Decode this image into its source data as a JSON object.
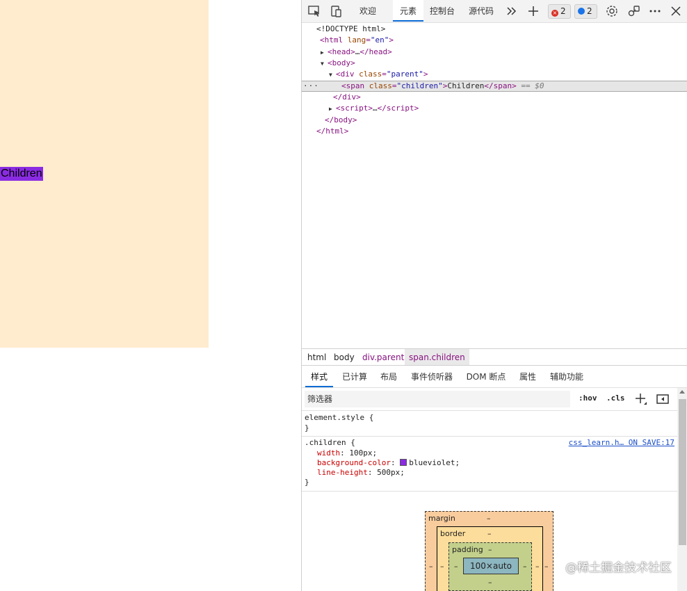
{
  "preview": {
    "children_text": "Children",
    "parent_color": "#ffebcd",
    "children_color": "#8a2be2"
  },
  "toolbar": {
    "tabs": [
      "欢迎",
      "元素",
      "控制台",
      "源代码"
    ],
    "active_tab": "元素",
    "errors_count": "2",
    "messages_count": "2",
    "icons": [
      "inspect-icon",
      "device-toggle-icon",
      "more-tabs-icon",
      "add-tab-icon",
      "settings-icon",
      "connect-icon",
      "more-icon",
      "close-icon"
    ]
  },
  "dom": {
    "doctype": "<!DOCTYPE html>",
    "html_tag": "html",
    "html_attr_name": "lang",
    "html_attr_val": "\"en\"",
    "head_collapsed": "head",
    "head_ellipsis": "…",
    "body_tag": "body",
    "div_tag": "div",
    "div_attr_name": "class",
    "div_attr_val": "\"parent\"",
    "span_tag": "span",
    "span_attr_name": "class",
    "span_attr_val": "\"children\"",
    "span_text": "Children",
    "selected_marker": "== $0",
    "script_tag": "script",
    "script_ellipsis": "…",
    "dots": "···"
  },
  "breadcrumb": [
    "html",
    "body",
    "div.parent",
    "span.children"
  ],
  "subtabs": [
    "样式",
    "已计算",
    "布局",
    "事件侦听器",
    "DOM 断点",
    "属性",
    "辅助功能"
  ],
  "filter": {
    "placeholder": "筛选器",
    "hov": ":hov",
    "cls": ".cls"
  },
  "styles": {
    "element_style_selector": "element.style {",
    "close_brace": "}",
    "children_selector": ".children {",
    "source_link": "css_learn.h… ON SAVE:17",
    "declarations": [
      {
        "prop": "width",
        "value": "100px;"
      },
      {
        "prop": "background-color",
        "value": "blueviolet;"
      },
      {
        "prop": "line-height",
        "value": "500px;"
      }
    ]
  },
  "box_model": {
    "margin_label": "margin",
    "border_label": "border",
    "padding_label": "padding",
    "content": "100×auto",
    "dash": "–"
  },
  "watermark": "@稀土掘金技术社区"
}
